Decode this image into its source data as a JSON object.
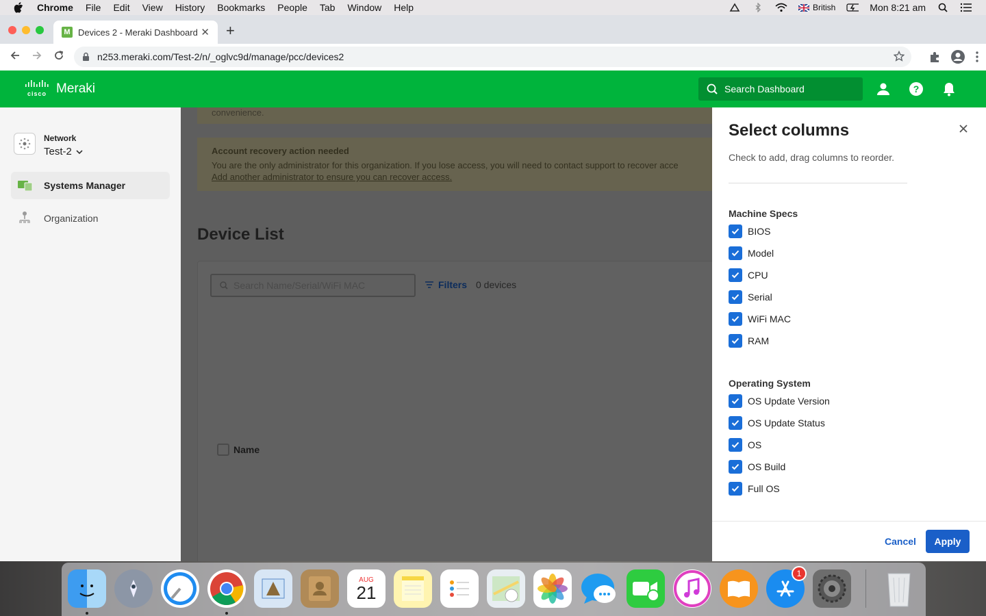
{
  "menubar": {
    "app": "Chrome",
    "items": [
      "File",
      "Edit",
      "View",
      "History",
      "Bookmarks",
      "People",
      "Tab",
      "Window",
      "Help"
    ],
    "input_source": "British",
    "clock": "Mon 8:21 am"
  },
  "browser": {
    "tab_title": "Devices 2 - Meraki Dashboard",
    "favicon_letter": "M",
    "url": "n253.meraki.com/Test-2/n/_oglvc9d/manage/pcc/devices2"
  },
  "header": {
    "cisco": "cisco",
    "brand": "Meraki",
    "search_placeholder": "Search Dashboard",
    "color": "#00b43c"
  },
  "sidebar": {
    "network_label": "Network",
    "network_name": "Test-2",
    "items": [
      {
        "label": "Systems Manager",
        "icon": "systems-manager-icon",
        "active": true
      },
      {
        "label": "Organization",
        "icon": "organization-icon",
        "active": false
      }
    ]
  },
  "main": {
    "banner_partial": "convenience.",
    "alert_title": "Account recovery action needed",
    "alert_text": "You are the only administrator for this organization. If you lose access, you will need to contact support to recover acce",
    "alert_link": "Add another administrator to ensure you can recover access.",
    "title": "Device List",
    "search_placeholder": "Search Name/Serial/WiFi MAC",
    "filters_label": "Filters",
    "device_count": "0 devices",
    "name_column": "Name"
  },
  "panel": {
    "title": "Select columns",
    "subtitle": "Check to add, drag columns to reorder.",
    "groups": [
      {
        "heading": "Machine Specs",
        "options": [
          "BIOS",
          "Model",
          "CPU",
          "Serial",
          "WiFi MAC",
          "RAM"
        ]
      },
      {
        "heading": "Operating System",
        "options": [
          "OS Update Version",
          "OS Update Status",
          "OS",
          "OS Build",
          "Full OS"
        ]
      }
    ],
    "cancel_label": "Cancel",
    "apply_label": "Apply",
    "accent": "#1a5fc8"
  },
  "dock": {
    "apps": [
      "Finder",
      "Launchpad",
      "Safari",
      "Chrome",
      "Mail",
      "Contacts",
      "Calendar",
      "Notes",
      "Reminders",
      "Maps",
      "Photos",
      "Messages",
      "FaceTime",
      "iTunes",
      "iBooks",
      "App Store",
      "System Preferences",
      "Trash"
    ],
    "calendar_month": "AUG",
    "calendar_day": "21",
    "appstore_badge": "1"
  }
}
